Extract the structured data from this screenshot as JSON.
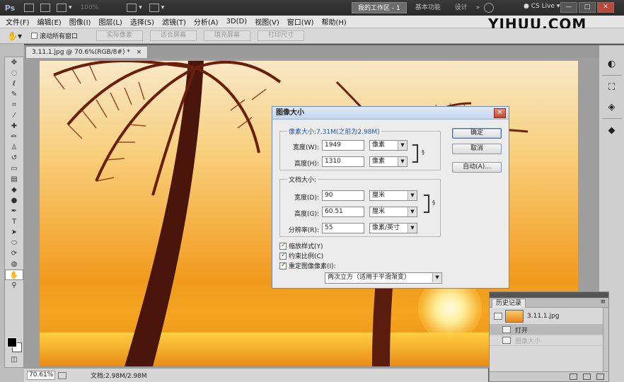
{
  "app": {
    "logo": "Ps",
    "zoom_display": "100%",
    "workspace_buttons": [
      "我的工作区 - 1",
      "基本功能",
      "设计"
    ],
    "cs_live": "CS Live",
    "win_controls": [
      "—",
      "□",
      "✕"
    ]
  },
  "brand": "YIHUU.COM",
  "menu": [
    "文件(F)",
    "编辑(E)",
    "图像(I)",
    "图层(L)",
    "选择(S)",
    "滤镜(T)",
    "分析(A)",
    "3D(D)",
    "视图(V)",
    "窗口(W)",
    "帮助(H)"
  ],
  "options": {
    "scroll_all_label": "滚动所有窗口",
    "buttons": [
      "实际像素",
      "适合屏幕",
      "填充屏幕",
      "打印尺寸"
    ]
  },
  "document_tab": "3.11.1.jpg @ 70.6%(RGB/8#) *",
  "status": {
    "zoom": "70.61%",
    "doc_info": "文档:2.98M/2.98M"
  },
  "dialog": {
    "title": "图像大小",
    "pixel_group_title": "像素大小:7.31M(之前为2.98M)",
    "width_label": "宽度(W):",
    "width_value": "1949",
    "width_unit": "像素",
    "height_label": "高度(H):",
    "height_value": "1310",
    "height_unit": "像素",
    "doc_group_title": "文档大小:",
    "doc_width_label": "宽度(D):",
    "doc_width_value": "90",
    "doc_width_unit": "厘米",
    "doc_height_label": "高度(G):",
    "doc_height_value": "60.51",
    "doc_height_unit": "厘米",
    "resolution_label": "分辨率(R):",
    "resolution_value": "55",
    "resolution_unit": "像素/英寸",
    "scale_styles": "缩放样式(Y)",
    "constrain": "约束比例(C)",
    "resample": "重定图像像素(I):",
    "resample_method": "两次立方（适用于平滑渐变）",
    "ok": "确定",
    "cancel": "取消",
    "auto": "自动(A)..."
  },
  "history": {
    "tab": "历史记录",
    "snapshot": "3.11.1.jpg",
    "rows": [
      "打开",
      "图像大小"
    ]
  }
}
